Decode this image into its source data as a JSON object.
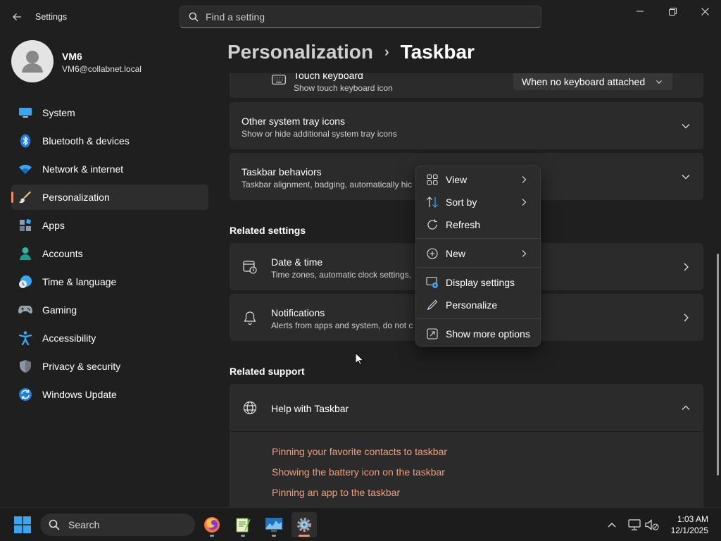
{
  "app": {
    "title": "Settings",
    "search_placeholder": "Find a setting"
  },
  "profile": {
    "name": "VM6",
    "email": "VM6@collabnet.local"
  },
  "nav": {
    "items": [
      {
        "label": "System",
        "icon": "monitor-icon"
      },
      {
        "label": "Bluetooth & devices",
        "icon": "bluetooth-icon"
      },
      {
        "label": "Network & internet",
        "icon": "wifi-icon"
      },
      {
        "label": "Personalization",
        "icon": "paintbrush-icon",
        "active": true
      },
      {
        "label": "Apps",
        "icon": "apps-icon"
      },
      {
        "label": "Accounts",
        "icon": "person-icon"
      },
      {
        "label": "Time & language",
        "icon": "globe-clock-icon"
      },
      {
        "label": "Gaming",
        "icon": "gamepad-icon"
      },
      {
        "label": "Accessibility",
        "icon": "accessibility-icon"
      },
      {
        "label": "Privacy & security",
        "icon": "shield-icon"
      },
      {
        "label": "Windows Update",
        "icon": "update-icon"
      }
    ]
  },
  "breadcrumb": {
    "parent": "Personalization",
    "separator": "›",
    "current": "Taskbar"
  },
  "settings": {
    "touch_keyboard": {
      "title": "Touch keyboard",
      "subtitle": "Show touch keyboard icon",
      "value": "When no keyboard attached"
    },
    "other_tray": {
      "title": "Other system tray icons",
      "subtitle": "Show or hide additional system tray icons"
    },
    "behaviors": {
      "title": "Taskbar behaviors",
      "subtitle": "Taskbar alignment, badging, automatically hic"
    }
  },
  "related_settings": {
    "heading": "Related settings",
    "items": [
      {
        "title": "Date & time",
        "subtitle": "Time zones, automatic clock settings,"
      },
      {
        "title": "Notifications",
        "subtitle": "Alerts from apps and system, do not c"
      }
    ]
  },
  "related_support": {
    "heading": "Related support",
    "help_title": "Help with Taskbar",
    "links": [
      "Pinning your favorite contacts to taskbar",
      "Showing the battery icon on the taskbar",
      "Pinning an app to the taskbar"
    ]
  },
  "context_menu": {
    "items": [
      {
        "label": "View",
        "icon": "view-grid-icon",
        "submenu": true
      },
      {
        "label": "Sort by",
        "icon": "sort-icon",
        "submenu": true
      },
      {
        "label": "Refresh",
        "icon": "refresh-icon",
        "submenu": false
      },
      {
        "label": "New",
        "icon": "new-plus-icon",
        "submenu": true
      },
      {
        "label": "Display settings",
        "icon": "display-settings-icon",
        "submenu": false
      },
      {
        "label": "Personalize",
        "icon": "pen-icon",
        "submenu": false
      },
      {
        "label": "Show more options",
        "icon": "show-more-icon",
        "submenu": false
      }
    ]
  },
  "taskbar": {
    "search_label": "Search",
    "time": "1:03 AM",
    "date": "12/1/2025"
  },
  "colors": {
    "accent": "#ef8d6b",
    "link": "#ef9f7c",
    "background": "#1f1f1f",
    "card": "#2b2b2b"
  }
}
